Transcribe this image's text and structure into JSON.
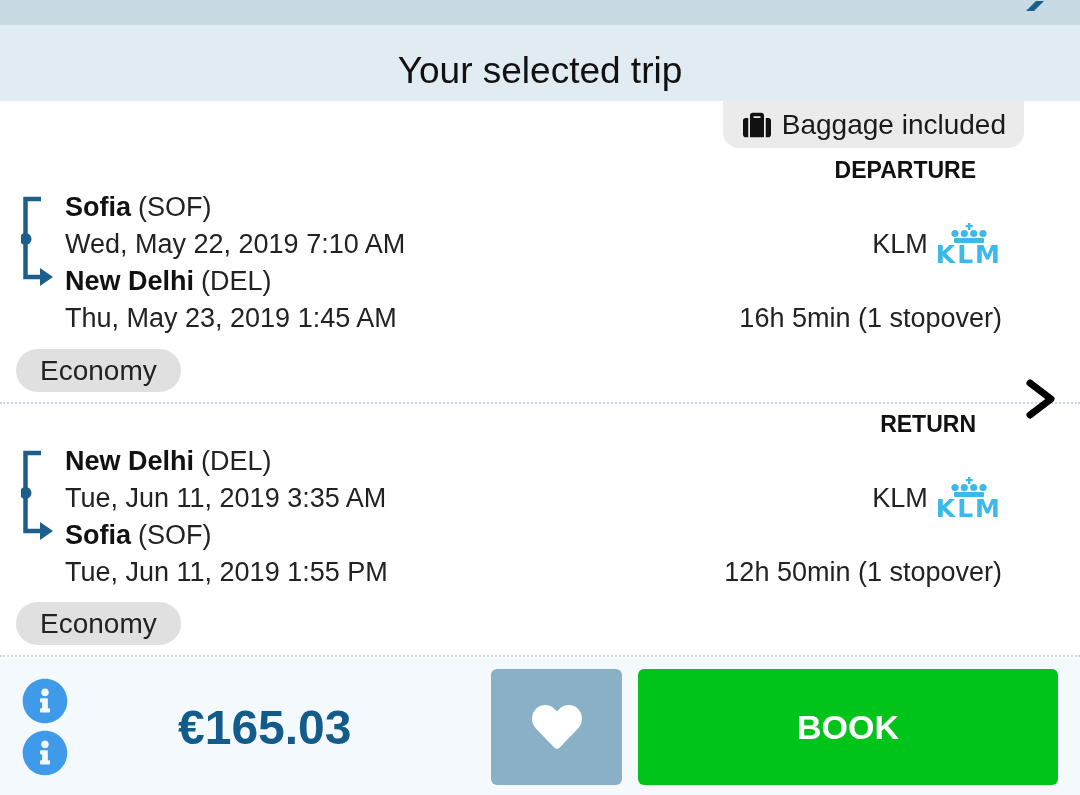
{
  "header": {
    "title": "Your selected trip"
  },
  "baggage_badge": {
    "label": "Baggage included"
  },
  "legs": [
    {
      "label": "DEPARTURE",
      "from": {
        "city": "Sofia",
        "code": "(SOF)",
        "time": "Wed, May 22, 2019 7:10 AM"
      },
      "to": {
        "city": "New Delhi",
        "code": "(DEL)",
        "time": "Thu, May 23, 2019 1:45 AM"
      },
      "airline": {
        "name": "KLM",
        "logo_text": "KLM"
      },
      "duration": "16h 5min (1 stopover)",
      "cabin": "Economy"
    },
    {
      "label": "RETURN",
      "from": {
        "city": "New Delhi",
        "code": "(DEL)",
        "time": "Tue, Jun 11, 2019 3:35 AM"
      },
      "to": {
        "city": "Sofia",
        "code": "(SOF)",
        "time": "Tue, Jun 11, 2019 1:55 PM"
      },
      "airline": {
        "name": "KLM",
        "logo_text": "KLM"
      },
      "duration": "12h 50min (1 stopover)",
      "cabin": "Economy"
    }
  ],
  "footer": {
    "price": "€165.03",
    "book_button": "BOOK"
  }
}
